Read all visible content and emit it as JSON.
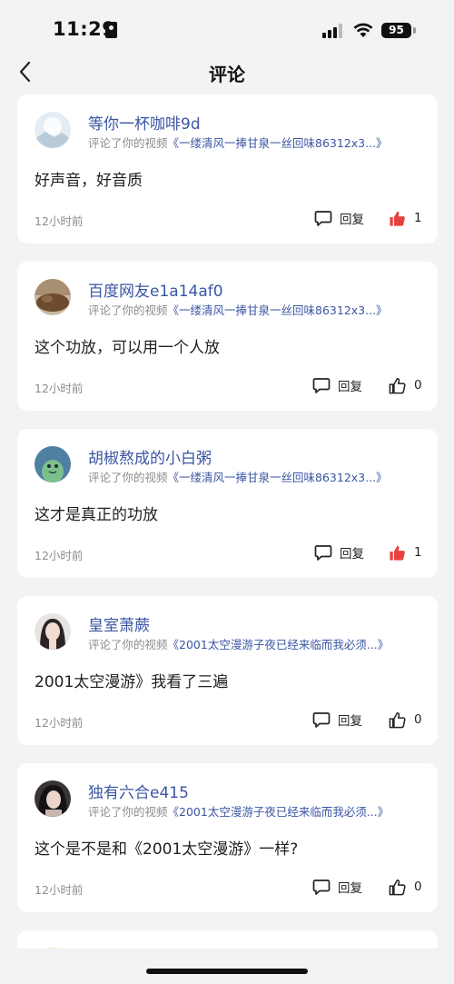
{
  "status_bar": {
    "time": "11:29",
    "battery": "95"
  },
  "nav": {
    "title": "评论"
  },
  "comments": [
    {
      "username": "等你一杯咖啡9d",
      "sub_prefix": "评论了你的视频",
      "video_title": "《一缕清风一捧甘泉一丝回味86312x3...》",
      "text": "好声音，好音质",
      "time": "12小时前",
      "reply_label": "回复",
      "likes": "1",
      "liked": true,
      "avatar_color": "#dfe9f1"
    },
    {
      "username": "百度网友e1a14af0",
      "sub_prefix": "评论了你的视频",
      "video_title": "《一缕清风一捧甘泉一丝回味86312x3...》",
      "text": "这个功放，可以用一个人放",
      "time": "12小时前",
      "reply_label": "回复",
      "likes": "0",
      "liked": false,
      "avatar_color": "#8a6a4a"
    },
    {
      "username": "胡椒熬成的小白粥",
      "sub_prefix": "评论了你的视频",
      "video_title": "《一缕清风一捧甘泉一丝回味86312x3...》",
      "text": "这才是真正的功放",
      "time": "12小时前",
      "reply_label": "回复",
      "likes": "1",
      "liked": true,
      "avatar_color": "#4f7fa3"
    },
    {
      "username": "皇室萧蕨",
      "sub_prefix": "评论了你的视频",
      "video_title": "《2001太空漫游子夜已经来临而我必须...》",
      "text": "2001太空漫游》我看了三遍",
      "time": "12小时前",
      "reply_label": "回复",
      "likes": "0",
      "liked": false,
      "avatar_color": "#d9d4d2"
    },
    {
      "username": "独有六合e415",
      "sub_prefix": "评论了你的视频",
      "video_title": "《2001太空漫游子夜已经来临而我必须...》",
      "text": "这个是不是和《2001太空漫游》一样?",
      "time": "12小时前",
      "reply_label": "回复",
      "likes": "0",
      "liked": false,
      "avatar_color": "#3a3436"
    }
  ],
  "colors": {
    "link": "#3a55a4",
    "like_active": "#e8413d",
    "background": "#f2f3f5"
  },
  "icons": {
    "back": "chevron-left-icon",
    "reply": "comment-bubble-icon",
    "like": "thumbs-up-icon"
  }
}
